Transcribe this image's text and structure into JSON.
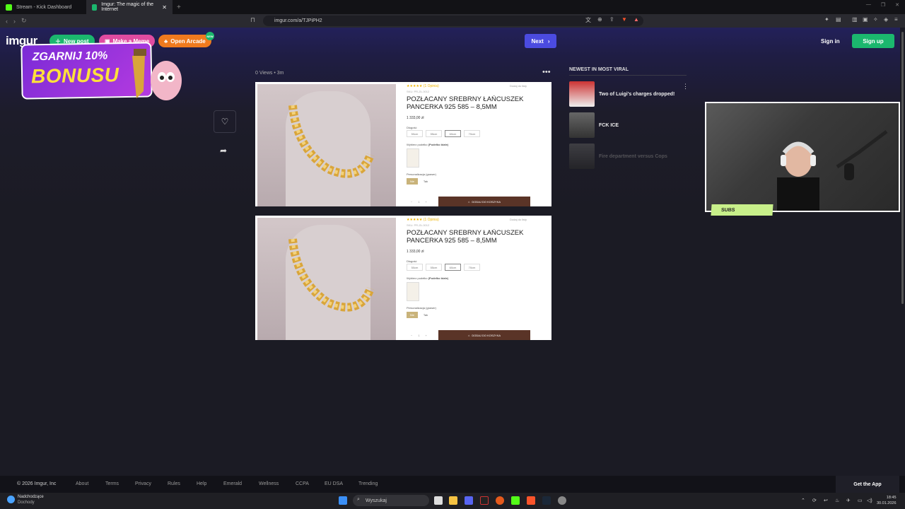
{
  "browser": {
    "tabs": [
      {
        "label": "Stream - Kick Dashboard",
        "active": false,
        "favicon_color": "#53fc18"
      },
      {
        "label": "Imgur: The magic of the Internet",
        "active": true,
        "favicon_color": "#1bb76e"
      }
    ],
    "url": "imgur.com/a/TJPiPH2"
  },
  "imgur": {
    "logo": "imgur",
    "new_post": "New post",
    "make_meme": "Make a Meme",
    "open_arcade": "Open Arcade",
    "arcade_badge": "NEW",
    "next": "Next",
    "sign_in": "Sign in",
    "sign_up": "Sign up",
    "views": "0 Views",
    "time": "3m",
    "newest_header": "NEWEST IN MOST VIRAL",
    "newest": [
      {
        "title": "Two of Luigi's charges dropped!"
      },
      {
        "title": "FCK ICE"
      },
      {
        "title": "Fire department versus Cops"
      }
    ]
  },
  "promo": {
    "line1": "ZGARNIJ 10%",
    "line2": "BONUSU"
  },
  "product": {
    "reviews": "(1 Opinia)",
    "favorite": "Dodaj do listy",
    "sku": "SKU: PR-ZŁ-0012",
    "title": "POZŁACANY SREBRNY ŁAŃCUSZEK PANCERKA 925 585 – 8,5MM",
    "price": "1 333,00 zł",
    "length_label": "Długość",
    "sizes": [
      "50cm",
      "55cm",
      "60cm",
      "70cm"
    ],
    "box_label": "Wybierz pudełko",
    "box_value": "(Pudełko białe)",
    "engraving_label": "Personalizacja (grawer)",
    "engraving_options": [
      "Nie",
      "Tak"
    ],
    "add_to_cart": "DODAJ DO KOSZYKA"
  },
  "stream": {
    "subs_label": "SUBS"
  },
  "footer": {
    "copyright": "© 2026 Imgur, Inc",
    "links": [
      "About",
      "Terms",
      "Privacy",
      "Rules",
      "Help",
      "Emerald",
      "Wellness",
      "CCPA",
      "EU DSA",
      "Trending"
    ],
    "get_app": "Get the App"
  },
  "taskbar": {
    "weather_title": "Nadchodzące",
    "weather_sub": "Dochody",
    "search": "Wyszukaj",
    "time": "18:45",
    "date": "30.01.2026"
  }
}
